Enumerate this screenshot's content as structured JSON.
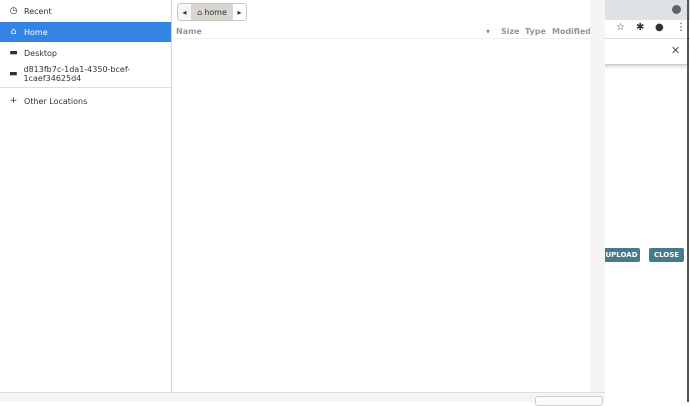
{
  "sidebar": {
    "items": [
      {
        "label": "Recent",
        "icon": "clock-icon"
      },
      {
        "label": "Home",
        "icon": "home-icon",
        "selected": true
      },
      {
        "label": "Desktop",
        "icon": "folder-icon"
      },
      {
        "label": "d813fb7c-1da1-4350-bcef-1caef34625d4",
        "icon": "drive-icon"
      },
      {
        "label": "Other Locations",
        "icon": "plus-icon"
      }
    ]
  },
  "pathbar": {
    "current": "home"
  },
  "columns": {
    "name": "Name",
    "size": "Size",
    "type": "Type",
    "modified": "Modified"
  },
  "background": {
    "upload": "UPLOAD",
    "close": "CLOSE",
    "accent": "#457b8c"
  }
}
